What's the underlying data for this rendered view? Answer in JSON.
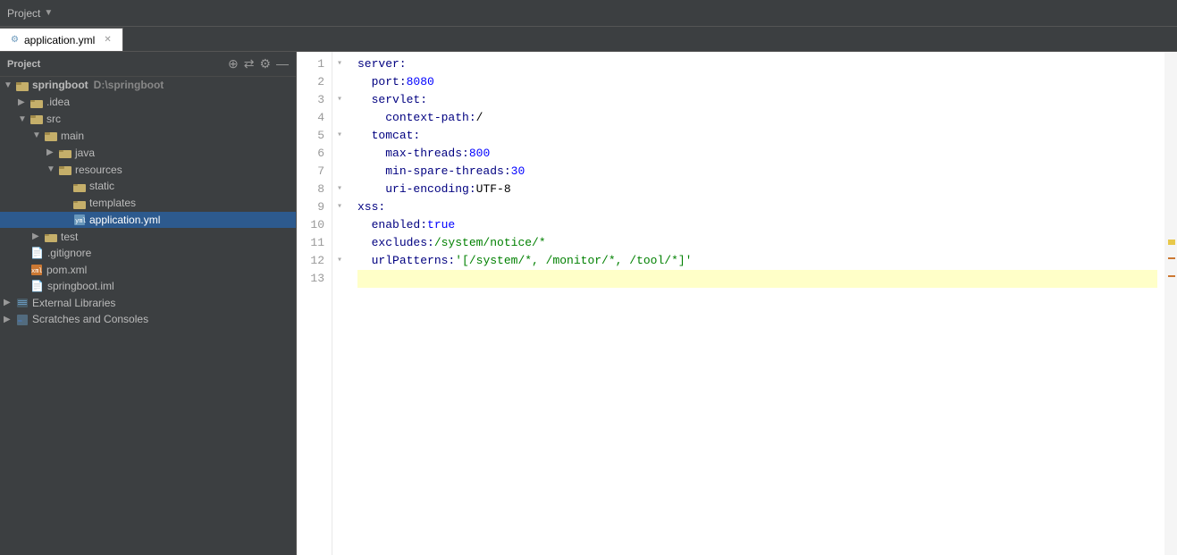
{
  "titlebar": {
    "project_label": "Project",
    "chevron": "▼"
  },
  "tabs": [
    {
      "id": "application-yml",
      "label": "application.yml",
      "active": true,
      "icon": "⚙"
    }
  ],
  "toolbar": {
    "icons": [
      "⊕",
      "⇄",
      "⚙",
      "—"
    ]
  },
  "sidebar": {
    "header": "Project",
    "tree": [
      {
        "id": "springboot",
        "label": "springboot",
        "suffix": "D:\\springboot",
        "level": 0,
        "type": "project",
        "arrow": "▼",
        "expanded": true
      },
      {
        "id": "idea",
        "label": ".idea",
        "level": 1,
        "type": "folder",
        "arrow": "▶",
        "expanded": false
      },
      {
        "id": "src",
        "label": "src",
        "level": 1,
        "type": "folder",
        "arrow": "▼",
        "expanded": true
      },
      {
        "id": "main",
        "label": "main",
        "level": 2,
        "type": "folder",
        "arrow": "▼",
        "expanded": true
      },
      {
        "id": "java",
        "label": "java",
        "level": 3,
        "type": "folder",
        "arrow": "▶",
        "expanded": false
      },
      {
        "id": "resources",
        "label": "resources",
        "level": 3,
        "type": "resources-folder",
        "arrow": "▼",
        "expanded": true
      },
      {
        "id": "static",
        "label": "static",
        "level": 4,
        "type": "folder",
        "arrow": "",
        "expanded": false
      },
      {
        "id": "templates",
        "label": "templates",
        "level": 4,
        "type": "folder",
        "arrow": "",
        "expanded": false
      },
      {
        "id": "application-yml",
        "label": "application.yml",
        "level": 4,
        "type": "yaml",
        "arrow": "",
        "selected": true
      },
      {
        "id": "test",
        "label": "test",
        "level": 2,
        "type": "folder",
        "arrow": "▶",
        "expanded": false
      },
      {
        "id": "gitignore",
        "label": ".gitignore",
        "level": 1,
        "type": "gitignore",
        "arrow": ""
      },
      {
        "id": "pom-xml",
        "label": "pom.xml",
        "level": 1,
        "type": "xml",
        "arrow": ""
      },
      {
        "id": "springboot-iml",
        "label": "springboot.iml",
        "level": 1,
        "type": "iml",
        "arrow": ""
      },
      {
        "id": "external-libraries",
        "label": "External Libraries",
        "level": 0,
        "type": "libraries",
        "arrow": "▶",
        "expanded": false
      },
      {
        "id": "scratches",
        "label": "Scratches and Consoles",
        "level": 0,
        "type": "scratch",
        "arrow": "▶",
        "expanded": false
      }
    ]
  },
  "editor": {
    "filename": "application.yml",
    "lines": [
      {
        "num": 1,
        "fold": true,
        "content": [
          {
            "type": "key",
            "text": "server:"
          }
        ]
      },
      {
        "num": 2,
        "fold": false,
        "content": [
          {
            "type": "indent",
            "text": "  "
          },
          {
            "type": "key",
            "text": "port:"
          },
          {
            "type": "space"
          },
          {
            "type": "value-num",
            "text": "8080"
          }
        ]
      },
      {
        "num": 3,
        "fold": true,
        "content": [
          {
            "type": "indent",
            "text": "  "
          },
          {
            "type": "key",
            "text": "servlet:"
          }
        ]
      },
      {
        "num": 4,
        "fold": false,
        "content": [
          {
            "type": "indent",
            "text": "    "
          },
          {
            "type": "key",
            "text": "context-path:"
          },
          {
            "type": "space"
          },
          {
            "type": "value",
            "text": "/"
          }
        ]
      },
      {
        "num": 5,
        "fold": true,
        "content": [
          {
            "type": "indent",
            "text": "  "
          },
          {
            "type": "key",
            "text": "tomcat:"
          }
        ]
      },
      {
        "num": 6,
        "fold": false,
        "content": [
          {
            "type": "indent",
            "text": "    "
          },
          {
            "type": "key",
            "text": "max-threads:"
          },
          {
            "type": "space"
          },
          {
            "type": "value-num",
            "text": "800"
          }
        ]
      },
      {
        "num": 7,
        "fold": false,
        "content": [
          {
            "type": "indent",
            "text": "    "
          },
          {
            "type": "key",
            "text": "min-spare-threads:"
          },
          {
            "type": "space"
          },
          {
            "type": "value-num",
            "text": "30"
          }
        ]
      },
      {
        "num": 8,
        "fold": true,
        "content": [
          {
            "type": "indent",
            "text": "    "
          },
          {
            "type": "key",
            "text": "uri-encoding:"
          },
          {
            "type": "space"
          },
          {
            "type": "value",
            "text": "UTF-8"
          }
        ]
      },
      {
        "num": 9,
        "fold": true,
        "content": [
          {
            "type": "key",
            "text": "xss:"
          }
        ]
      },
      {
        "num": 10,
        "fold": false,
        "content": [
          {
            "type": "indent",
            "text": "  "
          },
          {
            "type": "key",
            "text": "enabled:"
          },
          {
            "type": "space"
          },
          {
            "type": "value-bool",
            "text": "true"
          }
        ]
      },
      {
        "num": 11,
        "fold": false,
        "content": [
          {
            "type": "indent",
            "text": "  "
          },
          {
            "type": "key",
            "text": "excludes:"
          },
          {
            "type": "space"
          },
          {
            "type": "value-str",
            "text": "/system/notice/*"
          }
        ]
      },
      {
        "num": 12,
        "fold": true,
        "content": [
          {
            "type": "indent",
            "text": "  "
          },
          {
            "type": "key",
            "text": "urlPatterns:"
          },
          {
            "type": "space"
          },
          {
            "type": "value-str",
            "text": "'[/system/*, /monitor/*, /tool/*]'"
          }
        ]
      },
      {
        "num": 13,
        "fold": false,
        "content": [],
        "highlighted": true
      }
    ]
  }
}
